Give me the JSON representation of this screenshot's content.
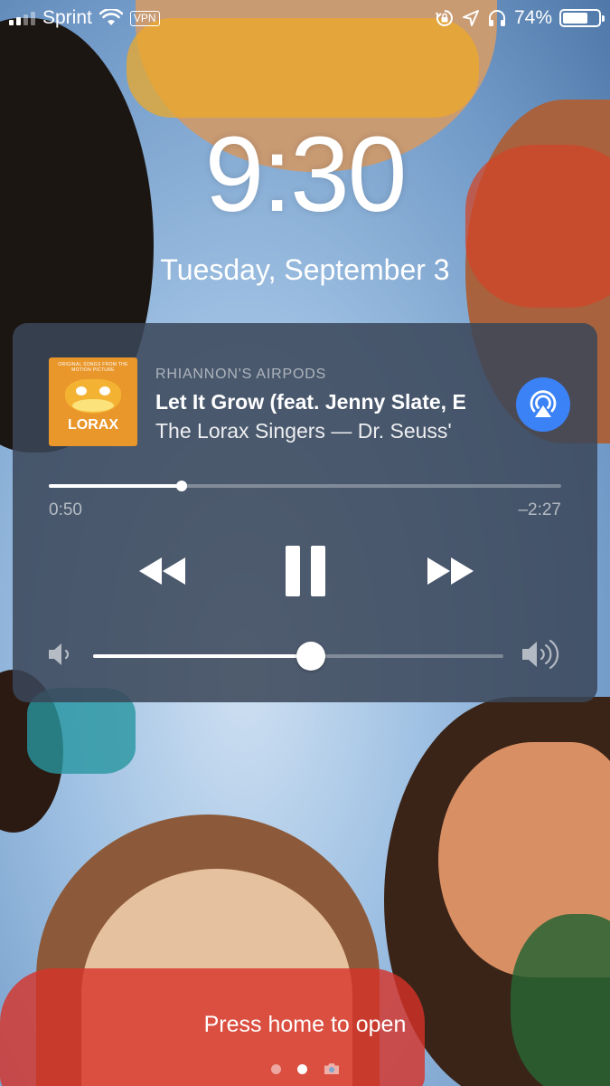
{
  "status_bar": {
    "carrier": "Sprint",
    "vpn_label": "VPN",
    "battery_percent_text": "74%",
    "battery_level": 0.74,
    "icons": [
      "signal-icon",
      "wifi-icon",
      "orientation-lock-icon",
      "location-icon",
      "headphones-icon",
      "battery-icon"
    ]
  },
  "lock_screen": {
    "time": "9:30",
    "date": "Tuesday, September 3"
  },
  "now_playing": {
    "device": "RHIANNON'S AIRPODS",
    "title": "Let It Grow (feat. Jenny Slate, E",
    "subtitle": "The Lorax Singers — Dr. Seuss'",
    "album_art": {
      "top_text": "ORIGINAL SONGS FROM THE MOTION PICTURE",
      "title_text": "LORAX",
      "background_color": "#e9962a"
    },
    "elapsed": "0:50",
    "remaining": "–2:27",
    "progress": 0.26,
    "volume": 0.53,
    "accent_color": "#3b82f6",
    "controls": {
      "rewind_icon": "rewind-icon",
      "pause_icon": "pause-icon",
      "forward_icon": "fast-forward-icon",
      "airplay_icon": "airplay-audio-icon"
    }
  },
  "footer": {
    "hint": "Press home to open",
    "page_count": 3,
    "active_page": 1,
    "camera_icon": "camera-icon"
  }
}
